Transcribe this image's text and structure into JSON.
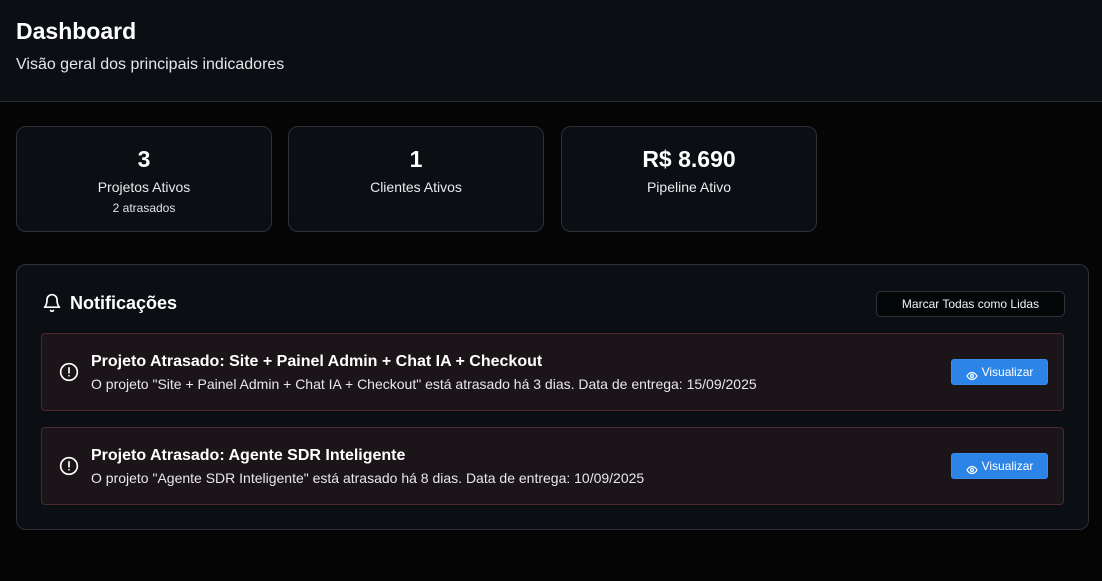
{
  "header": {
    "title": "Dashboard",
    "subtitle": "Visão geral dos principais indicadores"
  },
  "stats": [
    {
      "value": "3",
      "label": "Projetos Ativos",
      "sub": "2 atrasados"
    },
    {
      "value": "1",
      "label": "Clientes Ativos",
      "sub": ""
    },
    {
      "value": "R$ 8.690",
      "label": "Pipeline Ativo",
      "sub": ""
    }
  ],
  "notifications": {
    "title": "Notificações",
    "mark_all_label": "Marcar Todas como Lidas",
    "icon": "bell-icon",
    "items": [
      {
        "title": "Projeto Atrasado: Site + Painel Admin + Chat IA + Checkout",
        "description": "O projeto \"Site + Painel Admin + Chat IA + Checkout\" está atrasado há 3 dias. Data de entrega: 15/09/2025",
        "button_label": "Visualizar",
        "icon": "alert-circle-icon"
      },
      {
        "title": "Projeto Atrasado: Agente SDR Inteligente",
        "description": "O projeto \"Agente SDR Inteligente\" está atrasado há 8 dias. Data de entrega: 10/09/2025",
        "button_label": "Visualizar",
        "icon": "alert-circle-icon"
      }
    ]
  },
  "colors": {
    "background": "#050506",
    "card": "#0b0e12",
    "alert_bg": "#1b1418",
    "alert_border": "#4b2a2e",
    "accent": "#2b84e6"
  }
}
